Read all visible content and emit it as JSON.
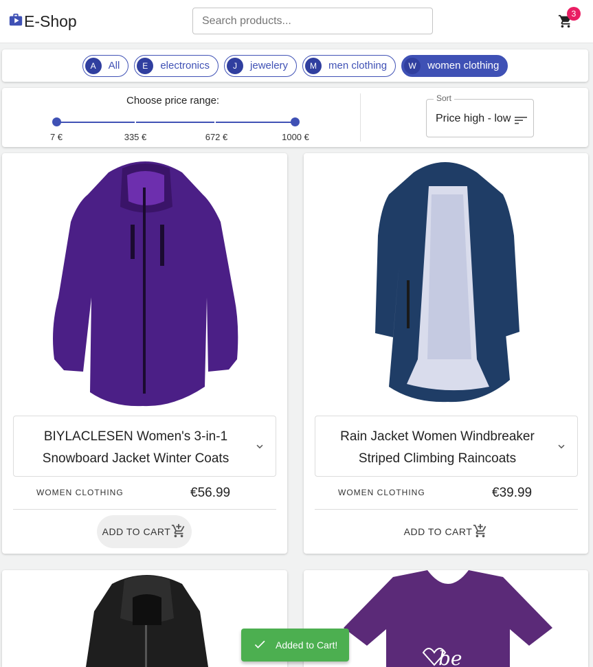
{
  "header": {
    "logo_text": "E-Shop",
    "search_placeholder": "Search products...",
    "cart_count": "3"
  },
  "categories": [
    {
      "avatar": "A",
      "label": "All",
      "active": false
    },
    {
      "avatar": "E",
      "label": "electronics",
      "active": false
    },
    {
      "avatar": "J",
      "label": "jewelery",
      "active": false
    },
    {
      "avatar": "M",
      "label": "men clothing",
      "active": false
    },
    {
      "avatar": "W",
      "label": "women clothing",
      "active": true
    }
  ],
  "price_filter": {
    "label": "Choose price range:",
    "ticks": [
      "7 €",
      "335 €",
      "672 €",
      "1000 €"
    ],
    "min": 7,
    "max": 1000,
    "selected_min": 7,
    "selected_max": 1000
  },
  "sort": {
    "legend": "Sort",
    "value": "Price high - low",
    "icon": "sort-icon"
  },
  "products": [
    {
      "title": "BIYLACLESEN Women's 3-in-1 Snowboard Jacket Winter Coats",
      "category": "WOMEN CLOTHING",
      "price": "€56.99",
      "button": "ADD TO CART",
      "image": "purple-jacket"
    },
    {
      "title": "Rain Jacket Women Windbreaker Striped Climbing Raincoats",
      "category": "WOMEN CLOTHING",
      "price": "€39.99",
      "button": "ADD TO CART",
      "image": "navy-raincoat"
    },
    {
      "image": "black-leather-jacket"
    },
    {
      "image": "purple-tshirt"
    }
  ],
  "toast": {
    "message": "Added to Cart!",
    "icon": "check-icon"
  },
  "colors": {
    "primary": "#3f51b5",
    "badge": "#e91e63",
    "toast": "#4caf50"
  }
}
